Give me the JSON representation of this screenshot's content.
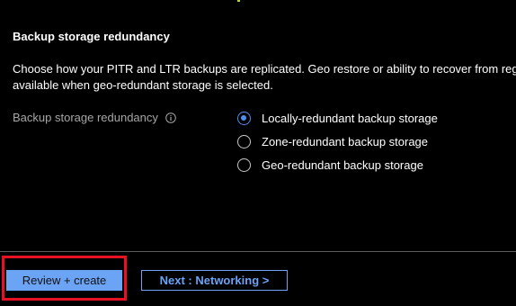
{
  "section": {
    "title": "Backup storage redundancy",
    "description_line1": "Choose how your PITR and LTR backups are replicated. Geo restore or ability to recover from regio",
    "description_line2": "available when geo-redundant storage is selected."
  },
  "field": {
    "label": "Backup storage redundancy",
    "info_icon": "info-icon"
  },
  "options": [
    {
      "label": "Locally-redundant backup storage",
      "selected": true
    },
    {
      "label": "Zone-redundant backup storage",
      "selected": false
    },
    {
      "label": "Geo-redundant backup storage",
      "selected": false
    }
  ],
  "footer": {
    "review_create_label": "Review + create",
    "next_label": "Next : Networking >"
  },
  "colors": {
    "background": "#000000",
    "accent": "#6ba3f5",
    "radio_selected": "#4f8ff0",
    "highlight": "#e81123"
  }
}
